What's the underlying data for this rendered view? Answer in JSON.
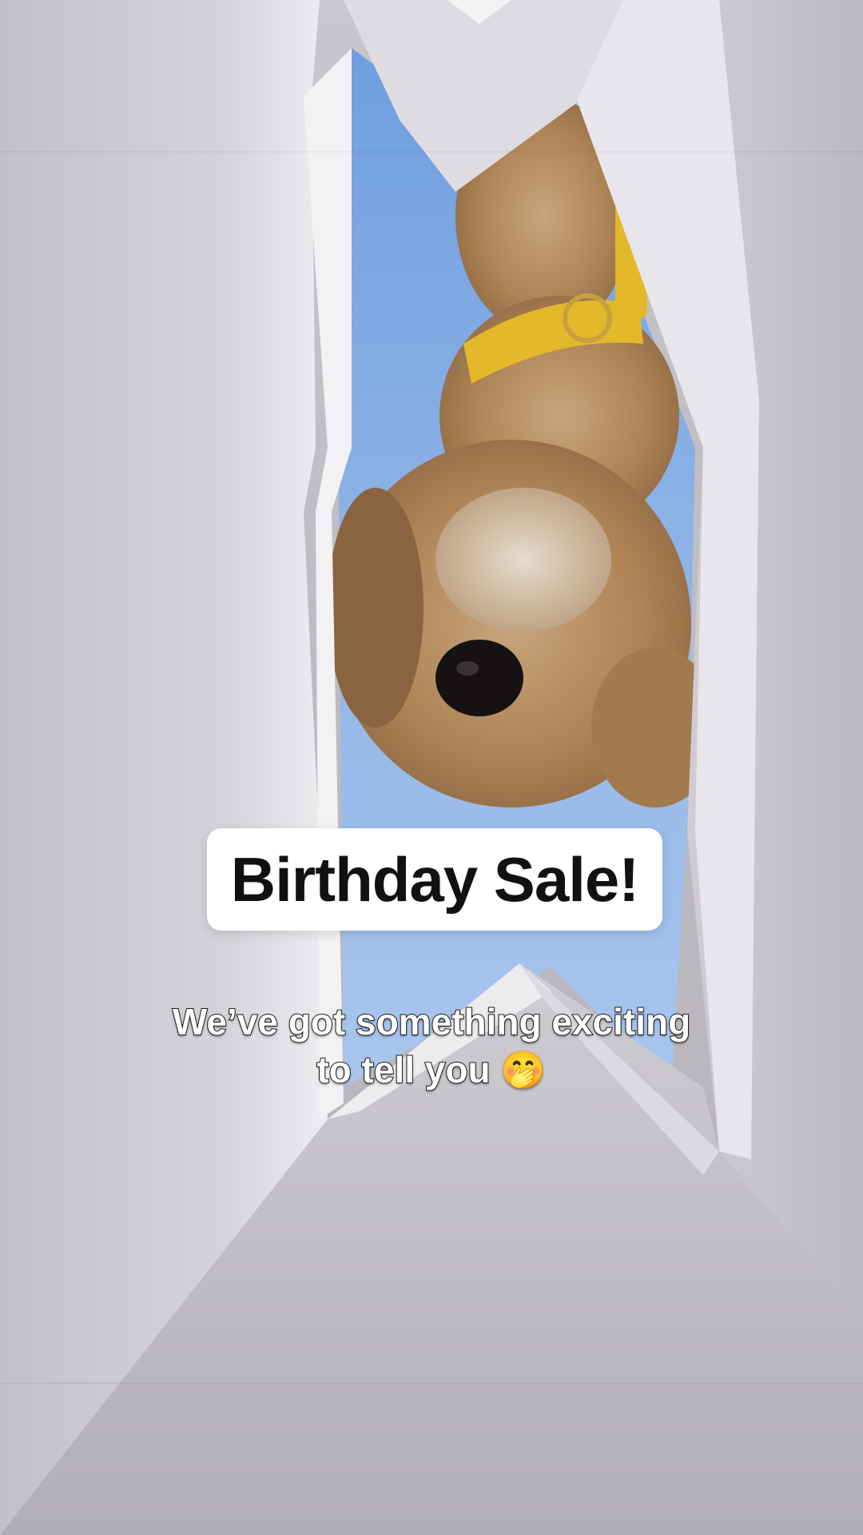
{
  "caption": {
    "title": "Birthday Sale!"
  },
  "subtitle": {
    "line1": "We’ve got something exciting",
    "line2": "to tell you 🤭"
  },
  "colors": {
    "sky": "#8fb4e6",
    "bag_interior": "#bdbac0",
    "collar": "#e3b82a",
    "fur": "#b08658",
    "caption_bg": "#ffffff"
  }
}
